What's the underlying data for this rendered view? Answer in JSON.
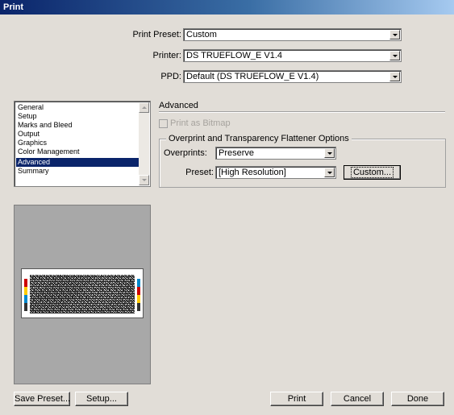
{
  "window": {
    "title": "Print"
  },
  "top": {
    "preset": {
      "label": "Print Preset:",
      "underline": "s",
      "value": "Custom"
    },
    "printer": {
      "label": "Printer:",
      "underline": "P",
      "value": "DS TRUEFLOW_E V1.4"
    },
    "ppd": {
      "label": "PPD:",
      "underline": "D",
      "value": "Default (DS TRUEFLOW_E V1.4)"
    }
  },
  "sidebar": {
    "items": [
      {
        "label": "General"
      },
      {
        "label": "Setup"
      },
      {
        "label": "Marks and Bleed"
      },
      {
        "label": "Output"
      },
      {
        "label": "Graphics"
      },
      {
        "label": "Color Management"
      },
      {
        "label": "Advanced",
        "selected": true
      },
      {
        "label": "Summary"
      }
    ]
  },
  "advanced": {
    "section_title": "Advanced",
    "print_as_bitmap": {
      "label": "Print as Bitmap",
      "checked": false,
      "enabled": false
    },
    "group_title": "Overprint and Transparency Flattener Options",
    "overprints": {
      "label": "Overprints:",
      "value": "Preserve"
    },
    "preset": {
      "label": "Preset:",
      "value": "[High Resolution]"
    },
    "custom_button": "Custom..."
  },
  "buttons": {
    "save_preset": "Save Preset...",
    "setup": "Setup...",
    "print": "Print",
    "cancel": "Cancel",
    "done": "Done"
  },
  "colors": {
    "titlebar": "#0a246a",
    "dialog_bg": "#e1ddd7",
    "selection": "#0a246a",
    "preview_bg": "#a8a8a8"
  }
}
